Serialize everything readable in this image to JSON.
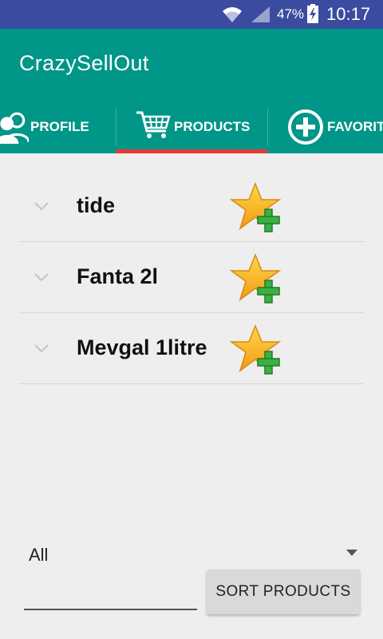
{
  "status_bar": {
    "battery": "47%",
    "time": "10:17"
  },
  "app": {
    "title": "CrazySellOut"
  },
  "tabs": [
    {
      "label": "PROFILE",
      "icon": "people-icon"
    },
    {
      "label": "PRODUCTS",
      "icon": "shopping-cart-icon",
      "selected": true
    },
    {
      "label": "FAVORITES",
      "icon": "add-circle-icon"
    }
  ],
  "products": [
    {
      "name": "tide"
    },
    {
      "name": "Fanta 2l"
    },
    {
      "name": "Mevgal 1litre"
    }
  ],
  "filter": {
    "selected": "All"
  },
  "search": {
    "value": "",
    "placeholder": ""
  },
  "sort_button": {
    "label": "SORT PRODUCTS"
  },
  "colors": {
    "status_bar": "#3a4ba0",
    "app_bar": "#009688",
    "tab_indicator": "#e53935",
    "background": "#eeeeee"
  }
}
